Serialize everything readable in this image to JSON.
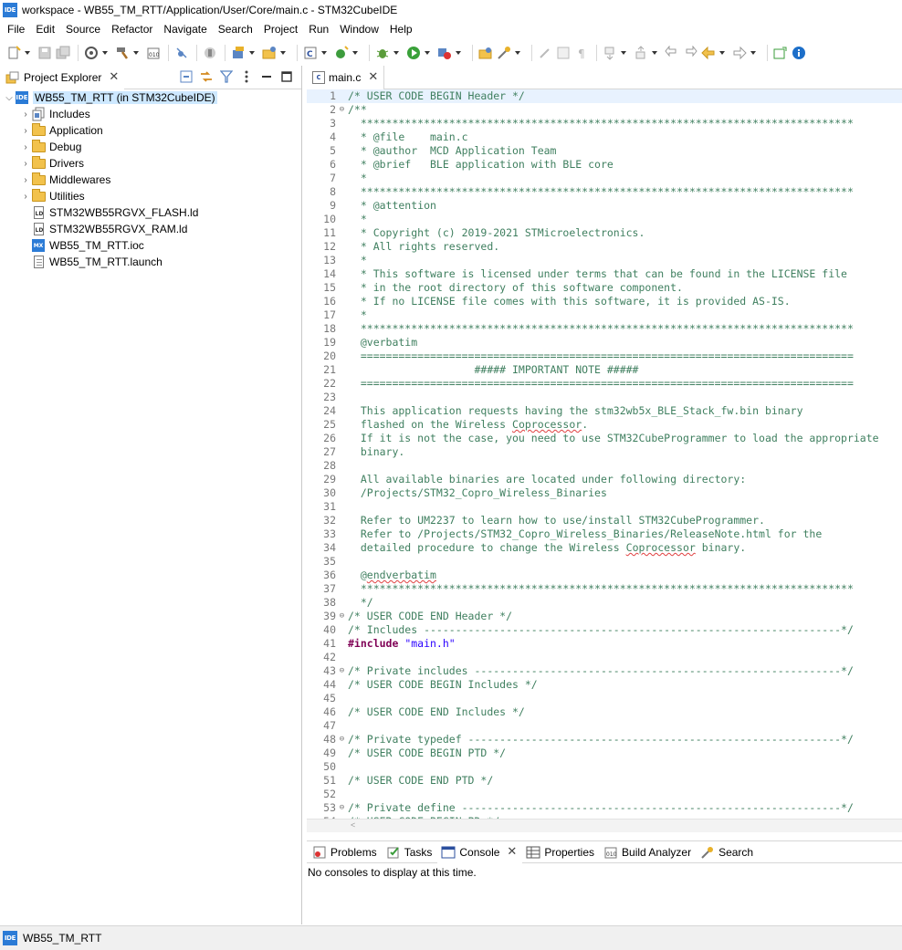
{
  "window": {
    "badge": "IDE",
    "title": "workspace - WB55_TM_RTT/Application/User/Core/main.c - STM32CubeIDE"
  },
  "menu": [
    "File",
    "Edit",
    "Source",
    "Refactor",
    "Navigate",
    "Search",
    "Project",
    "Run",
    "Window",
    "Help"
  ],
  "explorer": {
    "tab_label": "Project Explorer",
    "root": "WB55_TM_RTT (in STM32CubeIDE)",
    "items": [
      {
        "label": "Includes",
        "icon": "includes-icon"
      },
      {
        "label": "Application",
        "icon": "folder-icon"
      },
      {
        "label": "Debug",
        "icon": "folder-icon"
      },
      {
        "label": "Drivers",
        "icon": "folder-icon"
      },
      {
        "label": "Middlewares",
        "icon": "folder-icon"
      },
      {
        "label": "Utilities",
        "icon": "folder-icon"
      },
      {
        "label": "STM32WB55RGVX_FLASH.ld",
        "icon": "linker-file-icon"
      },
      {
        "label": "STM32WB55RGVX_RAM.ld",
        "icon": "linker-file-icon"
      },
      {
        "label": "WB55_TM_RTT.ioc",
        "icon": "ioc-file-icon"
      },
      {
        "label": "WB55_TM_RTT.launch",
        "icon": "launch-file-icon"
      }
    ]
  },
  "editor": {
    "tab_label": "main.c",
    "lines": [
      {
        "n": "1",
        "t": "/* USER CODE BEGIN Header */"
      },
      {
        "n": "2",
        "t": "/**",
        "fold": true
      },
      {
        "n": "3",
        "t": "  ******************************************************************************"
      },
      {
        "n": "4",
        "t": "  * @file    main.c"
      },
      {
        "n": "5",
        "t": "  * @author  MCD Application Team"
      },
      {
        "n": "6",
        "t": "  * @brief   BLE application with BLE core"
      },
      {
        "n": "7",
        "t": "  *"
      },
      {
        "n": "8",
        "t": "  ******************************************************************************"
      },
      {
        "n": "9",
        "t": "  * @attention"
      },
      {
        "n": "10",
        "t": "  *"
      },
      {
        "n": "11",
        "t": "  * Copyright (c) 2019-2021 STMicroelectronics."
      },
      {
        "n": "12",
        "t": "  * All rights reserved."
      },
      {
        "n": "13",
        "t": "  *"
      },
      {
        "n": "14",
        "t": "  * This software is licensed under terms that can be found in the LICENSE file"
      },
      {
        "n": "15",
        "t": "  * in the root directory of this software component."
      },
      {
        "n": "16",
        "t": "  * If no LICENSE file comes with this software, it is provided AS-IS."
      },
      {
        "n": "17",
        "t": "  *"
      },
      {
        "n": "18",
        "t": "  ******************************************************************************"
      },
      {
        "n": "19",
        "t": "  @verbatim"
      },
      {
        "n": "20",
        "t": "  =============================================================================="
      },
      {
        "n": "21",
        "t": "                    ##### IMPORTANT NOTE #####"
      },
      {
        "n": "22",
        "t": "  =============================================================================="
      },
      {
        "n": "23",
        "t": ""
      },
      {
        "n": "24",
        "t": "  This application requests having the stm32wb5x_BLE_Stack_fw.bin binary"
      },
      {
        "n": "25",
        "t": "  flashed on the Wireless Coprocessor."
      },
      {
        "n": "26",
        "t": "  If it is not the case, you need to use STM32CubeProgrammer to load the appropriate"
      },
      {
        "n": "27",
        "t": "  binary."
      },
      {
        "n": "28",
        "t": ""
      },
      {
        "n": "29",
        "t": "  All available binaries are located under following directory:"
      },
      {
        "n": "30",
        "t": "  /Projects/STM32_Copro_Wireless_Binaries"
      },
      {
        "n": "31",
        "t": ""
      },
      {
        "n": "32",
        "t": "  Refer to UM2237 to learn how to use/install STM32CubeProgrammer."
      },
      {
        "n": "33",
        "t": "  Refer to /Projects/STM32_Copro_Wireless_Binaries/ReleaseNote.html for the"
      },
      {
        "n": "34",
        "t": "  detailed procedure to change the Wireless Coprocessor binary."
      },
      {
        "n": "35",
        "t": ""
      },
      {
        "n": "36",
        "t": "  @endverbatim"
      },
      {
        "n": "37",
        "t": "  ******************************************************************************"
      },
      {
        "n": "38",
        "t": "  */"
      },
      {
        "n": "39",
        "t": "/* USER CODE END Header */",
        "fold": true
      },
      {
        "n": "40",
        "t": "/* Includes ------------------------------------------------------------------*/"
      },
      {
        "n": "41",
        "t": "#include ",
        "dir": true,
        "str": "\"main.h\""
      },
      {
        "n": "42",
        "t": ""
      },
      {
        "n": "43",
        "t": "/* Private includes ----------------------------------------------------------*/",
        "fold": true
      },
      {
        "n": "44",
        "t": "/* USER CODE BEGIN Includes */"
      },
      {
        "n": "45",
        "t": ""
      },
      {
        "n": "46",
        "t": "/* USER CODE END Includes */"
      },
      {
        "n": "47",
        "t": ""
      },
      {
        "n": "48",
        "t": "/* Private typedef -----------------------------------------------------------*/",
        "fold": true
      },
      {
        "n": "49",
        "t": "/* USER CODE BEGIN PTD */"
      },
      {
        "n": "50",
        "t": ""
      },
      {
        "n": "51",
        "t": "/* USER CODE END PTD */"
      },
      {
        "n": "52",
        "t": ""
      },
      {
        "n": "53",
        "t": "/* Private define ------------------------------------------------------------*/",
        "fold": true
      },
      {
        "n": "54",
        "t": "/* USER CODE BEGIN PD */"
      }
    ]
  },
  "bottom_panel": {
    "tabs": [
      {
        "label": "Problems",
        "icon": "problems-icon"
      },
      {
        "label": "Tasks",
        "icon": "tasks-icon"
      },
      {
        "label": "Console",
        "icon": "console-icon",
        "active": true
      },
      {
        "label": "Properties",
        "icon": "properties-icon"
      },
      {
        "label": "Build Analyzer",
        "icon": "build-analyzer-icon"
      },
      {
        "label": "Search",
        "icon": "search-icon"
      }
    ],
    "message": "No consoles to display at this time."
  },
  "status": {
    "badge": "IDE",
    "project": "WB55_TM_RTT"
  }
}
